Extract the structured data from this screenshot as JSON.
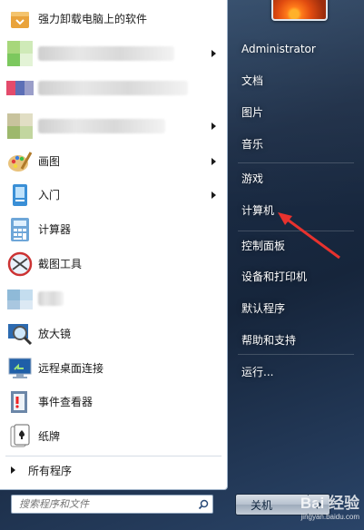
{
  "user": {
    "name": "Administrator"
  },
  "programs": [
    {
      "label": "强力卸载电脑上的软件",
      "icon": "uninstall-icon",
      "submenu": false,
      "blurred": false
    },
    {
      "label": "",
      "icon": "blurred-icon",
      "submenu": true,
      "blurred": true
    },
    {
      "label": "",
      "icon": "blurred-icon",
      "submenu": false,
      "blurred": true
    },
    {
      "label": "",
      "icon": "blurred-icon",
      "submenu": true,
      "blurred": true
    },
    {
      "label": "画图",
      "icon": "paint-icon",
      "submenu": true,
      "blurred": false
    },
    {
      "label": "入门",
      "icon": "getting-started-icon",
      "submenu": true,
      "blurred": false
    },
    {
      "label": "计算器",
      "icon": "calculator-icon",
      "submenu": false,
      "blurred": false
    },
    {
      "label": "截图工具",
      "icon": "snipping-tool-icon",
      "submenu": false,
      "blurred": false
    },
    {
      "label": "",
      "icon": "blurred-icon",
      "submenu": false,
      "blurred": true
    },
    {
      "label": "放大镜",
      "icon": "magnifier-icon",
      "submenu": false,
      "blurred": false
    },
    {
      "label": "远程桌面连接",
      "icon": "remote-desktop-icon",
      "submenu": false,
      "blurred": false
    },
    {
      "label": "事件查看器",
      "icon": "event-viewer-icon",
      "submenu": false,
      "blurred": false
    },
    {
      "label": "纸牌",
      "icon": "solitaire-icon",
      "submenu": false,
      "blurred": false
    }
  ],
  "all_programs": "所有程序",
  "search": {
    "placeholder": "搜索程序和文件"
  },
  "right_links": [
    "Administrator",
    "文档",
    "图片",
    "音乐",
    "游戏",
    "计算机",
    "控制面板",
    "设备和打印机",
    "默认程序",
    "帮助和支持",
    "运行..."
  ],
  "shutdown": {
    "label": "关机"
  },
  "watermark": {
    "line1": "Bai 经验",
    "line2": "jingyan.baidu.com"
  },
  "colors": {
    "accent_arrow": "#e8322e",
    "pane_bg": "#ffffff",
    "right_bg": "#1b2c45"
  }
}
